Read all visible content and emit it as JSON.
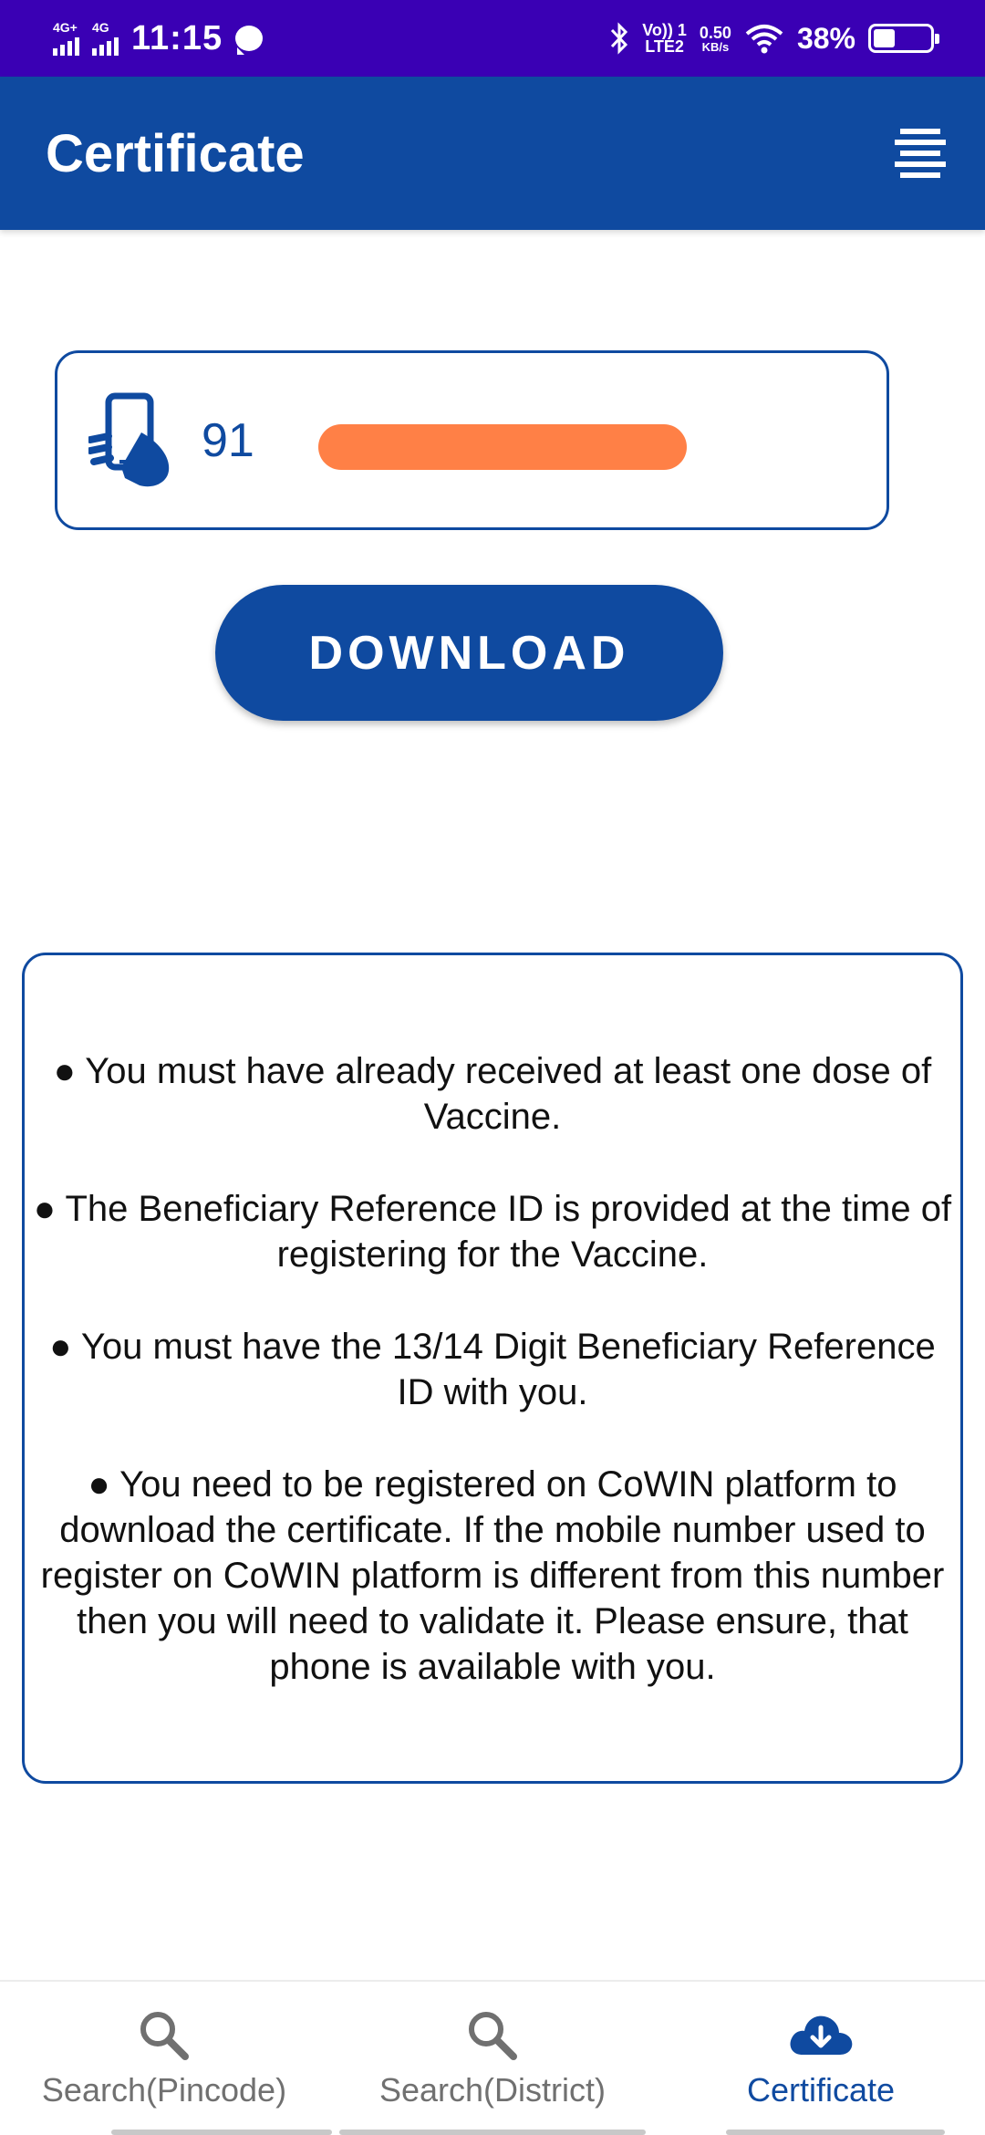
{
  "status_bar": {
    "sim1_label": "4G+",
    "sim2_label": "4G",
    "time": "11:15",
    "volte_line1": "Vo)) 1",
    "volte_line2": "LTE2",
    "speed_value": "0.50",
    "speed_unit": "KB/s",
    "battery_percent": "38%",
    "battery_level": 0.38
  },
  "app_bar": {
    "title": "Certificate",
    "menu_icon": "menu-icon"
  },
  "phone_input": {
    "icon": "phone-in-hand-icon",
    "value": "91"
  },
  "download_button": {
    "label": "DOWNLOAD"
  },
  "info": {
    "items": [
      "● You must have already received at least one dose of Vaccine.",
      "● The Beneficiary Reference ID is provided at the time of registering for the Vaccine.",
      "● You must have the 13/14 Digit Beneficiary Reference ID with you.",
      "● You need to be registered on CoWIN platform to download the certificate. If the mobile number used to register on CoWIN platform is different from this number then you will need to validate it. Please ensure, that phone is available with you."
    ]
  },
  "bottom_nav": {
    "items": [
      {
        "label": "Search(Pincode)",
        "icon": "search-icon",
        "active": false
      },
      {
        "label": "Search(District)",
        "icon": "search-icon",
        "active": false
      },
      {
        "label": "Certificate",
        "icon": "cloud-download-icon",
        "active": true
      }
    ]
  },
  "colors": {
    "status_bar": "#3a00b4",
    "primary": "#0f4aa0",
    "redaction": "#ff8046",
    "nav_inactive": "#707070"
  }
}
